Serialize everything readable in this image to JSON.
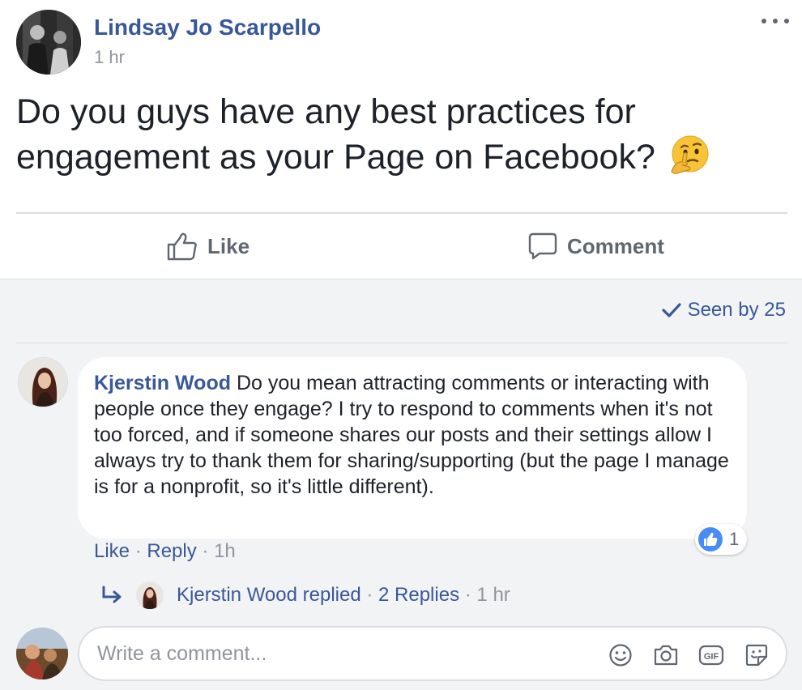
{
  "post": {
    "author": "Lindsay Jo Scarpello",
    "time": "1 hr",
    "text": "Do you guys have any best practices for engagement as your Page on Facebook?",
    "emoji_icon": "thinking-face-emoji"
  },
  "actions": {
    "like_label": "Like",
    "comment_label": "Comment"
  },
  "seen_by": "Seen by 25",
  "comment": {
    "author": "Kjerstin Wood",
    "text": "Do you mean attracting comments or interacting with people once they engage? I try to respond to comments when it's not too forced, and if someone shares our posts and their settings allow I always try to thank them for sharing/supporting (but the page I manage is for a nonprofit, so it's little different).",
    "reaction_count": "1",
    "like_label": "Like",
    "reply_label": "Reply",
    "time": "1h",
    "separator": "·"
  },
  "replies": {
    "replied_text": "Kjerstin Wood replied",
    "count_text": "2 Replies",
    "time": "1 hr",
    "separator": "·"
  },
  "composer": {
    "placeholder": "Write a comment...",
    "icons": [
      "smiley-icon",
      "camera-icon",
      "gif-icon",
      "sticker-icon"
    ]
  },
  "colors": {
    "link_blue": "#385898",
    "muted_gray": "#90949c",
    "action_gray": "#606770",
    "comments_bg": "#f2f3f5",
    "like_blue": "#4a8cf7"
  }
}
